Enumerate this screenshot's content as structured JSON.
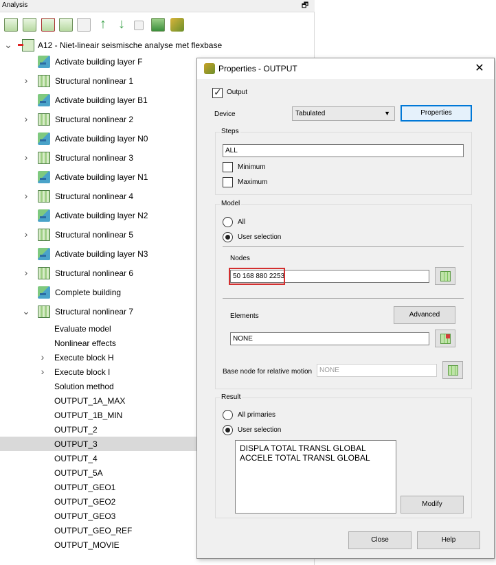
{
  "panel": {
    "title": "Analysis",
    "float_glyph": "🗗",
    "toolbar": [
      "new-analysis-icon",
      "add-command-icon",
      "copy-analysis-icon",
      "paste-analysis-icon",
      "disabled-copy-icon",
      "move-up-icon",
      "move-down-icon",
      "duplicate-icon",
      "export-icon",
      "run-analysis-icon"
    ],
    "root_label": "A12 - Niet-lineair seismische analyse met flexbase",
    "tree_items": [
      {
        "label": "Activate building layer F",
        "icon": "layer-icon",
        "expandable": false
      },
      {
        "label": "Structural nonlinear 1",
        "icon": "nonlinear-icon",
        "expandable": true
      },
      {
        "label": "Activate building layer B1",
        "icon": "layer-icon",
        "expandable": false
      },
      {
        "label": "Structural nonlinear 2",
        "icon": "nonlinear-icon",
        "expandable": true
      },
      {
        "label": "Activate building layer N0",
        "icon": "layer-icon",
        "expandable": false
      },
      {
        "label": "Structural nonlinear 3",
        "icon": "nonlinear-icon",
        "expandable": true
      },
      {
        "label": "Activate building layer N1",
        "icon": "layer-icon",
        "expandable": false
      },
      {
        "label": "Structural nonlinear 4",
        "icon": "nonlinear-icon",
        "expandable": true
      },
      {
        "label": "Activate building layer N2",
        "icon": "layer-icon",
        "expandable": false
      },
      {
        "label": "Structural nonlinear 5",
        "icon": "nonlinear-icon",
        "expandable": true
      },
      {
        "label": "Activate building layer N3",
        "icon": "layer-icon",
        "expandable": false
      },
      {
        "label": "Structural nonlinear 6",
        "icon": "nonlinear-icon",
        "expandable": true
      },
      {
        "label": "Complete building",
        "icon": "layer-icon",
        "expandable": false
      },
      {
        "label": "Structural nonlinear 7",
        "icon": "nonlinear-icon",
        "expandable": true,
        "expanded": true
      }
    ],
    "sub_items": [
      {
        "label": "Evaluate model",
        "expandable": false
      },
      {
        "label": "Nonlinear effects",
        "expandable": false
      },
      {
        "label": "Execute block H",
        "expandable": true
      },
      {
        "label": "Execute block I",
        "expandable": true
      },
      {
        "label": "Solution method",
        "expandable": false
      },
      {
        "label": "OUTPUT_1A_MAX",
        "expandable": false
      },
      {
        "label": "OUTPUT_1B_MIN",
        "expandable": false
      },
      {
        "label": "OUTPUT_2",
        "expandable": false
      },
      {
        "label": "OUTPUT_3",
        "expandable": false,
        "selected": true
      },
      {
        "label": "OUTPUT_4",
        "expandable": false
      },
      {
        "label": "OUTPUT_5A",
        "expandable": false
      },
      {
        "label": "OUTPUT_GEO1",
        "expandable": false
      },
      {
        "label": "OUTPUT_GEO2",
        "expandable": false
      },
      {
        "label": "OUTPUT_GEO3",
        "expandable": false
      },
      {
        "label": "OUTPUT_GEO_REF",
        "expandable": false
      },
      {
        "label": "OUTPUT_MOVIE",
        "expandable": false
      }
    ]
  },
  "dialog": {
    "title": "Properties - OUTPUT",
    "close_glyph": "✕",
    "output_label": "Output",
    "output_checked": true,
    "device_label": "Device",
    "device_value": "Tabulated",
    "properties_button": "Properties",
    "steps": {
      "label": "Steps",
      "value": "ALL",
      "minimum_label": "Minimum",
      "minimum_checked": false,
      "maximum_label": "Maximum",
      "maximum_checked": false
    },
    "model": {
      "label": "Model",
      "all_label": "All",
      "user_selection_label": "User selection",
      "selected": "user_selection",
      "nodes_label": "Nodes",
      "nodes_value": "50 168 880 2253",
      "elements_label": "Elements",
      "advanced_button": "Advanced",
      "elements_value": "NONE",
      "base_node_label": "Base node for relative motion",
      "base_node_placeholder": "NONE"
    },
    "result": {
      "label": "Result",
      "all_primaries_label": "All primaries",
      "user_selection_label": "User selection",
      "selected": "user_selection",
      "list": [
        "DISPLA TOTAL TRANSL GLOBAL",
        "ACCELE TOTAL TRANSL GLOBAL"
      ],
      "modify_button": "Modify"
    },
    "close_button": "Close",
    "help_button": "Help"
  },
  "colors": {
    "selection": "#d9d9d9",
    "highlight_box": "#d32f2f",
    "default_button_border": "#0078d7"
  }
}
